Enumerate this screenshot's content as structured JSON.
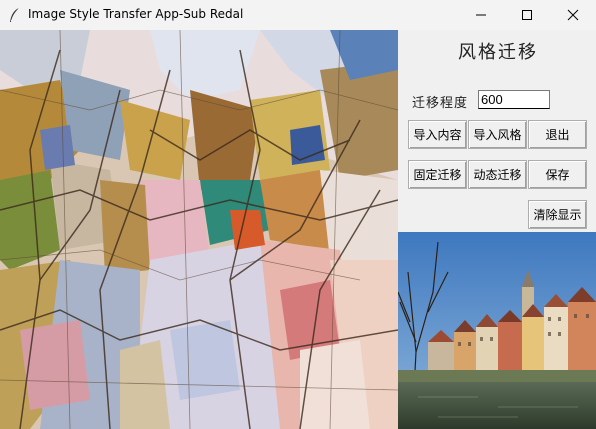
{
  "window": {
    "title": "Image Style Transfer App-Sub Redal",
    "app_icon": "feather-icon",
    "controls": [
      "minimize-icon",
      "maximize-icon",
      "close-icon"
    ]
  },
  "panel": {
    "title": "风格迁移",
    "degree_label": "迁移程度",
    "degree_value": "600"
  },
  "buttons": {
    "import_content": "导入内容",
    "import_style": "导入风格",
    "exit": "退出",
    "fixed_transfer": "固定迁移",
    "dynamic_transfer": "动态迁移",
    "save": "保存",
    "clear_display": "清除显示"
  },
  "colors": {
    "titlebar": "#f3f3f3",
    "panel": "#f0f0f0",
    "sky": "#4f87c6",
    "water": "#44533a"
  }
}
